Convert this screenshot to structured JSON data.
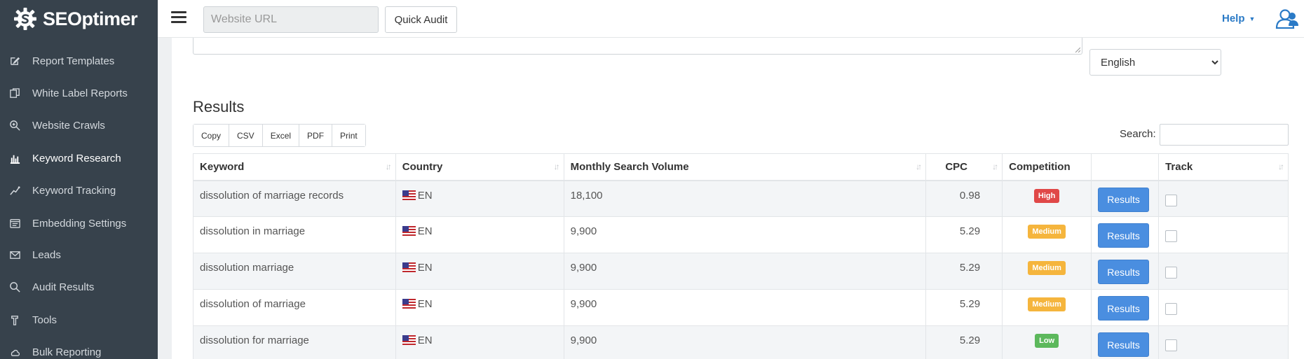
{
  "app": {
    "brand": "SEOptimer"
  },
  "sidebar": {
    "items": [
      {
        "label": "Report Templates",
        "icon": "edit-icon",
        "active": false
      },
      {
        "label": "White Label Reports",
        "icon": "copy-icon",
        "active": false
      },
      {
        "label": "Website Crawls",
        "icon": "zoom-search-icon",
        "active": false
      },
      {
        "label": "Keyword Research",
        "icon": "bar-chart-icon",
        "active": true
      },
      {
        "label": "Keyword Tracking",
        "icon": "trend-line-icon",
        "active": false
      },
      {
        "label": "Embedding Settings",
        "icon": "embed-window-icon",
        "active": false
      },
      {
        "label": "Leads",
        "icon": "envelope-icon",
        "active": false
      },
      {
        "label": "Audit Results",
        "icon": "search-icon",
        "active": false
      },
      {
        "label": "Tools",
        "icon": "hammer-icon",
        "active": false
      },
      {
        "label": "Bulk Reporting",
        "icon": "cloud-upload-icon",
        "active": false
      }
    ]
  },
  "topbar": {
    "url_placeholder": "Website URL",
    "url_value": "",
    "quick_audit_label": "Quick Audit",
    "help_label": "Help"
  },
  "settings": {
    "language_selected": "English"
  },
  "results": {
    "title": "Results",
    "export_buttons": [
      "Copy",
      "CSV",
      "Excel",
      "PDF",
      "Print"
    ],
    "search_label": "Search:",
    "search_value": "",
    "columns": [
      "Keyword",
      "Country",
      "Monthly Search Volume",
      "CPC",
      "Competition",
      "",
      "Track"
    ],
    "results_button_label": "Results",
    "rows": [
      {
        "keyword": "dissolution of marriage records",
        "country": "EN",
        "volume": "18,100",
        "cpc": "0.98",
        "competition": "High",
        "track": false
      },
      {
        "keyword": "dissolution in marriage",
        "country": "EN",
        "volume": "9,900",
        "cpc": "5.29",
        "competition": "Medium",
        "track": false
      },
      {
        "keyword": "dissolution marriage",
        "country": "EN",
        "volume": "9,900",
        "cpc": "5.29",
        "competition": "Medium",
        "track": false
      },
      {
        "keyword": "dissolution of marriage",
        "country": "EN",
        "volume": "9,900",
        "cpc": "5.29",
        "competition": "Medium",
        "track": false
      },
      {
        "keyword": "dissolution for marriage",
        "country": "EN",
        "volume": "9,900",
        "cpc": "5.29",
        "competition": "Low",
        "track": false
      }
    ]
  },
  "colors": {
    "sidebar_bg": "#37424c",
    "accent_blue": "#4a8ee0",
    "help_link": "#2a7ac6",
    "competition_high": "#e04848",
    "competition_medium": "#f5b53d",
    "competition_low": "#5cb85c"
  }
}
